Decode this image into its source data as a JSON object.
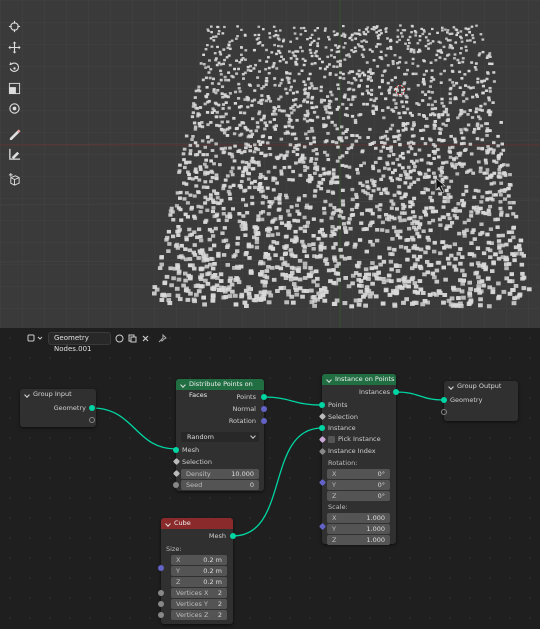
{
  "editor": {
    "tree_name": "Geometry Nodes.001"
  },
  "nodes": {
    "group_input": {
      "title": "Group Input",
      "geometry": "Geometry"
    },
    "distribute": {
      "title": "Distribute Points on Faces",
      "out_points": "Points",
      "out_normal": "Normal",
      "out_rotation": "Rotation",
      "mode": "Random",
      "in_mesh": "Mesh",
      "in_selection": "Selection",
      "density_label": "Density",
      "density_value": "10.000",
      "seed_label": "Seed",
      "seed_value": "0"
    },
    "instance": {
      "title": "Instance on Points",
      "out_instances": "Instances",
      "in_points": "Points",
      "in_selection": "Selection",
      "in_instance": "Instance",
      "pick_instance": "Pick Instance",
      "instance_index": "Instance Index",
      "rotation_label": "Rotation:",
      "rot_x_label": "X",
      "rot_x": "0°",
      "rot_y_label": "Y",
      "rot_y": "0°",
      "rot_z_label": "Z",
      "rot_z": "0°",
      "scale_label": "Scale:",
      "sc_x_label": "X",
      "sc_x": "1.000",
      "sc_y_label": "Y",
      "sc_y": "1.000",
      "sc_z_label": "Z",
      "sc_z": "1.000"
    },
    "group_output": {
      "title": "Group Output",
      "geometry": "Geometry"
    },
    "cube": {
      "title": "Cube",
      "out_mesh": "Mesh",
      "size_label": "Size:",
      "size_x_label": "X",
      "size_x": "0.2 m",
      "size_y_label": "Y",
      "size_y": "0.2 m",
      "size_z_label": "Z",
      "size_z": "0.2 m",
      "vx_label": "Vertices X",
      "vx": "2",
      "vy_label": "Vertices Y",
      "vy": "2",
      "vz_label": "Vertices Z",
      "vz": "2"
    }
  },
  "toolbar": {
    "tools": [
      "cursor-icon",
      "move-icon",
      "rotate-icon",
      "scale-icon",
      "transform-icon",
      "annotate-icon",
      "measure-icon",
      "add-cube-icon"
    ]
  },
  "colors": {
    "geometry_socket": "#00d6a3",
    "vector_socket": "#6363c7",
    "float_socket": "#a1a1a1",
    "geometry_node_header": "#226e43",
    "mesh_primitive_header": "#8a2a2a",
    "viewport_bg": "#3a3a3a",
    "instance_color": "#d9d9d9"
  }
}
